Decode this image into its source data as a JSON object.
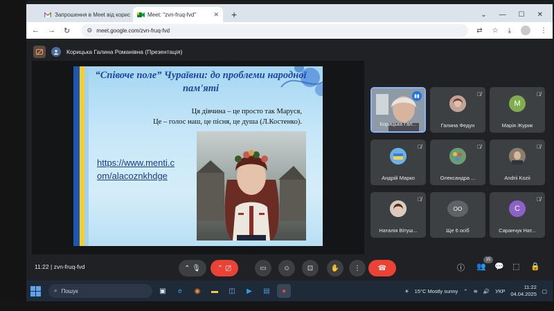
{
  "browser": {
    "tabs": [
      {
        "title": "Запрошення в Meet від корис",
        "icon": "gmail-icon",
        "active": false
      },
      {
        "title": "Meet: \"zvn-fruq-fvd\"",
        "icon": "meet-icon",
        "active": true
      }
    ],
    "new_tab_label": "+",
    "address": "meet.google.com/zvn-fruq-fvd"
  },
  "meeting": {
    "presenter_label": "Корицька Галина Романівна (Презентація)",
    "code": "zvn-fruq-fvd",
    "time": "11:22",
    "participants_count": "15"
  },
  "slide": {
    "title": "“Співоче поле” Чураївни: до проблеми народної пам'яті",
    "quote_line1": "Ця дівчина – це просто так Маруся,",
    "quote_line2": "Це – голос наш, це пісня, це душа (Л.Костенко).",
    "link": "https://www.menti.com/alacoznkhdge"
  },
  "participants": [
    {
      "name": "Корицька Гал...",
      "avatar": "",
      "avatar_color": "#7a7f86",
      "muted": false,
      "speaking": true
    },
    {
      "name": "Галина Федун",
      "avatar": "",
      "avatar_color": "#b98f86",
      "muted": true,
      "speaking": false
    },
    {
      "name": "Марія Журик",
      "avatar": "M",
      "avatar_color": "#7fae4e",
      "muted": true,
      "speaking": false
    },
    {
      "name": "Андрій Марко",
      "avatar": "",
      "avatar_color": "#3f7fd0",
      "muted": true,
      "speaking": false
    },
    {
      "name": "Олександра ...",
      "avatar": "",
      "avatar_color": "#4e8d5a",
      "muted": true,
      "speaking": false
    },
    {
      "name": "Andrii Kozii",
      "avatar": "",
      "avatar_color": "#6a6050",
      "muted": true,
      "speaking": false
    },
    {
      "name": "Наталія Вітуш...",
      "avatar": "",
      "avatar_color": "#c9b6a8",
      "muted": true,
      "speaking": false
    },
    {
      "name": "Ще 6 осіб",
      "avatar": "ОО",
      "avatar_color": "#5f6368",
      "muted": false,
      "speaking": false
    },
    {
      "name": "Саранчук Нат...",
      "avatar": "C",
      "avatar_color": "#8c62c9",
      "muted": true,
      "speaking": false
    }
  ],
  "taskbar": {
    "search_placeholder": "Пошук",
    "weather": "15°C  Mostly sunny",
    "language": "УКР",
    "clock_time": "11:22",
    "clock_date": "04.04.2025"
  },
  "colors": {
    "meet_bg": "#202124",
    "tile_bg": "#3c4043",
    "hangup_red": "#ea4335",
    "accent_blue": "#8ab4f8",
    "slide_title_blue": "#1f44a8"
  }
}
